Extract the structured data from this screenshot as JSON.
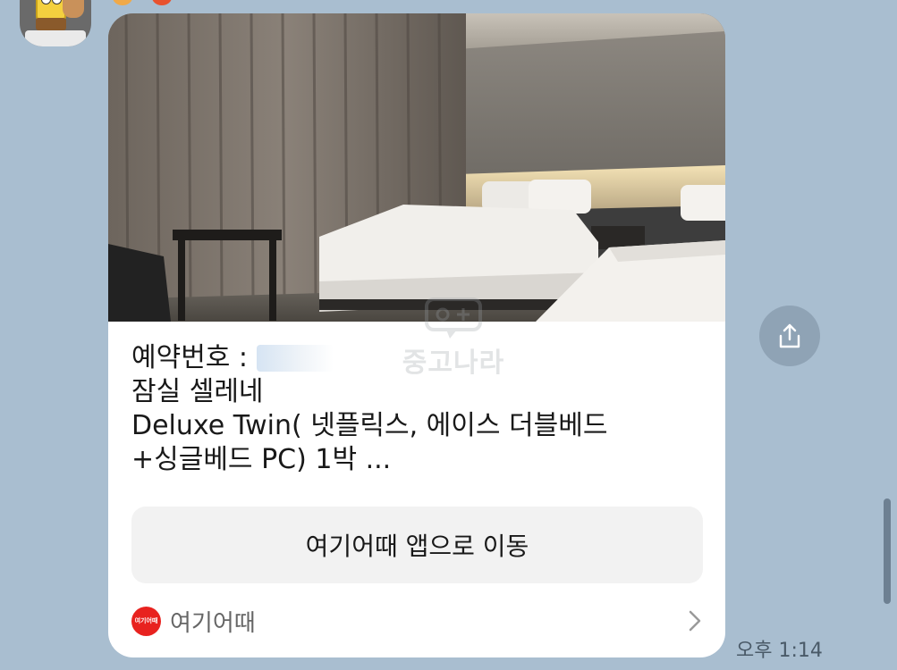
{
  "message": {
    "reservation_label": "예약번호 :",
    "hotel_name": "잠실 셀레네",
    "room_description": "Deluxe Twin( 넷플릭스,  에이스 더블베드+싱글베드 PC) 1박  ...",
    "action_button_label": "여기어때 앱으로 이동",
    "app_icon_text": "여기어때",
    "app_name": "여기어때",
    "time": "오후 1:14"
  },
  "watermark": {
    "text": "중고나라"
  },
  "colors": {
    "background": "#a9bed0",
    "card": "#ffffff",
    "button": "#f2f2f2",
    "app_brand": "#e8221f",
    "share_button": "#8fa3b5"
  },
  "icons": {
    "share": "share-icon",
    "chevron": "chevron-right-icon"
  }
}
